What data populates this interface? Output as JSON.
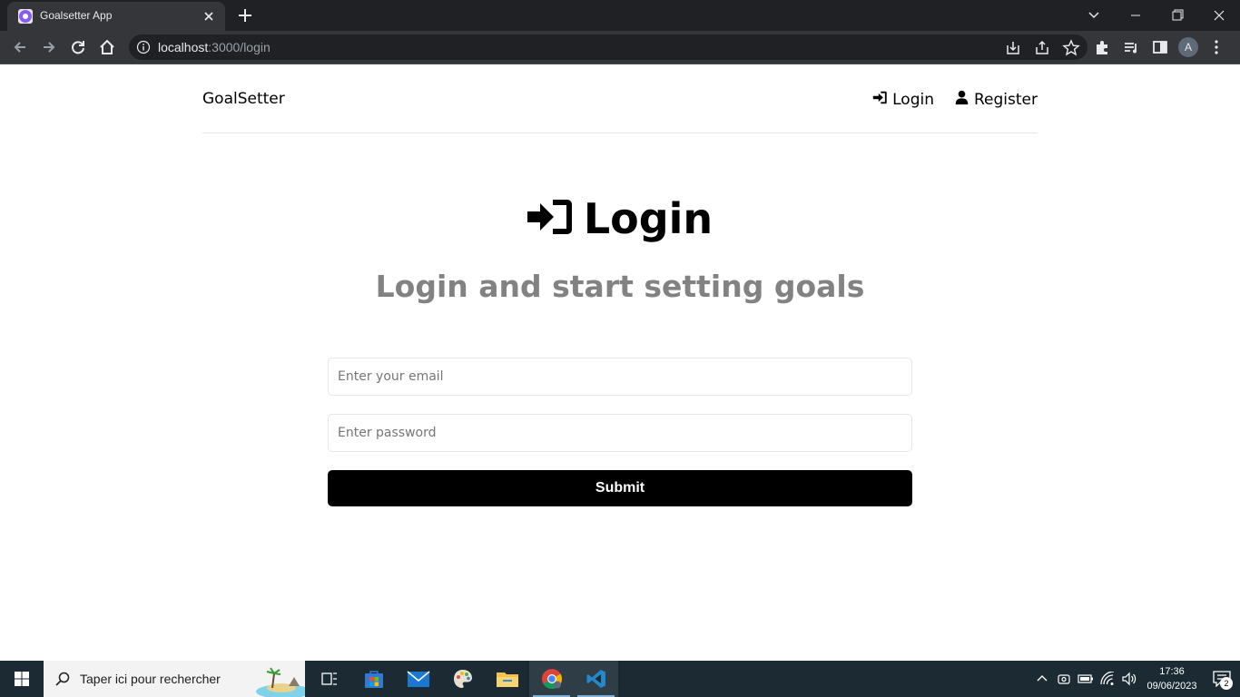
{
  "browser": {
    "tab_title": "Goalsetter App",
    "url_host": "localhost",
    "url_rest": ":3000/login",
    "profile_initial": "A"
  },
  "header": {
    "brand": "GoalSetter",
    "nav": [
      {
        "label": "Login",
        "icon": "sign-in-icon"
      },
      {
        "label": "Register",
        "icon": "user-icon"
      }
    ]
  },
  "main": {
    "heading": "Login",
    "heading_icon": "sign-in-icon",
    "subheading": "Login and start setting goals"
  },
  "form": {
    "email_placeholder": "Enter your email",
    "password_placeholder": "Enter password",
    "submit_label": "Submit"
  },
  "taskbar": {
    "search_placeholder": "Taper ici pour rechercher",
    "time": "17:36",
    "date": "09/06/2023",
    "notification_count": "2"
  },
  "colors": {
    "accent": "#000000",
    "subheading": "#828282",
    "chrome_bg": "#202124",
    "taskbar_bg": "#1b2a33"
  }
}
